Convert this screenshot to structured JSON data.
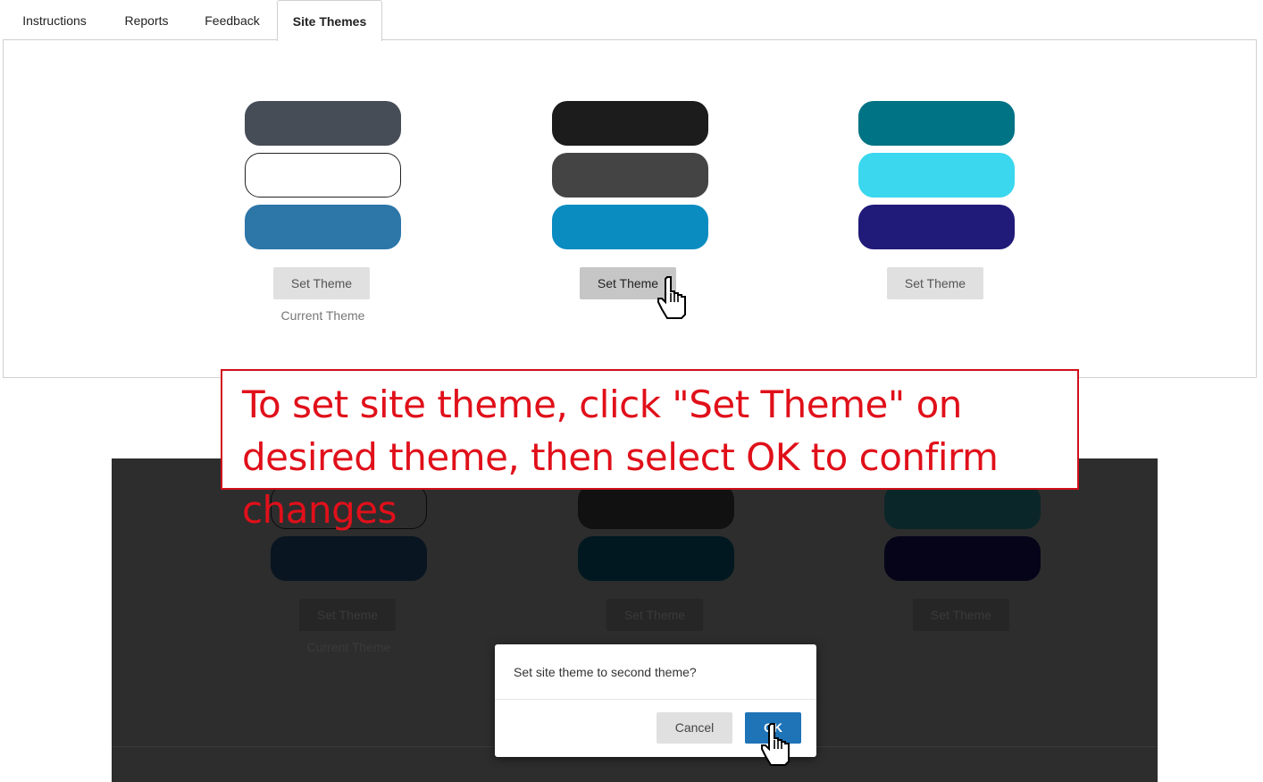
{
  "tabs": [
    {
      "label": "Instructions",
      "active": false
    },
    {
      "label": "Reports",
      "active": false
    },
    {
      "label": "Feedback",
      "active": false
    },
    {
      "label": "Site Themes",
      "active": true
    }
  ],
  "themes": [
    {
      "colors": [
        "#474d57",
        "#ffffff",
        "#2c76a8"
      ],
      "button_label": "Set Theme",
      "status_label": "Current Theme"
    },
    {
      "colors": [
        "#1c1c1c",
        "#444444",
        "#0a8cc1"
      ],
      "button_label": "Set Theme",
      "status_label": ""
    },
    {
      "colors": [
        "#007384",
        "#3ad7ee",
        "#201a78"
      ],
      "button_label": "Set Theme",
      "status_label": ""
    }
  ],
  "callout": {
    "text": "To set site theme, click \"Set Theme\" on desired theme, then select OK to confirm changes",
    "color": "#e0101a"
  },
  "modal_screenshot": {
    "themes": [
      {
        "colors": [
          "#101417",
          "#2d2d2d",
          "#091520"
        ],
        "button_label": "Set Theme",
        "status_label": "Current Theme"
      },
      {
        "colors": [
          "#0c0c0c",
          "#111111",
          "#021820"
        ],
        "button_label": "Set Theme",
        "status_label": ""
      },
      {
        "colors": [
          "#011c20",
          "#0b2628",
          "#050419"
        ],
        "button_label": "Set Theme",
        "status_label": ""
      }
    ],
    "dialog": {
      "message": "Set site theme to second theme?",
      "cancel_label": "Cancel",
      "ok_label": "OK"
    }
  },
  "icons": [
    "hand-pointer-icon"
  ]
}
